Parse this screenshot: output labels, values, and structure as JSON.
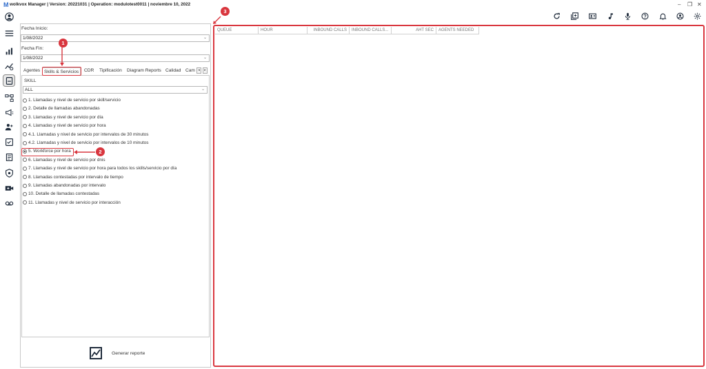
{
  "titlebar": {
    "logo": "M",
    "title": "wolkvox Manager  | Version: 20221031  |  Operation: modulotest0011  |  noviembre 10, 2022",
    "minimize": "–",
    "restore": "❐",
    "close": "✕"
  },
  "form": {
    "fecha_inicio_label": "Fecha Inicio:",
    "fecha_inicio_value": "1/08/2022",
    "fecha_fin_label": "Fecha Fin:",
    "fecha_fin_value": "1/08/2022"
  },
  "tabs": [
    {
      "label": "Agentes"
    },
    {
      "label": "Skills & Servicios"
    },
    {
      "label": "CDR"
    },
    {
      "label": "Tipificación"
    },
    {
      "label": "Diagram Reports"
    },
    {
      "label": "Calidad"
    },
    {
      "label": "Cam"
    }
  ],
  "tabnav": {
    "prev": "◂",
    "next": "▸"
  },
  "skill": {
    "label": "SKILL",
    "value": "ALL"
  },
  "reports": [
    {
      "label": "1. Llamadas y nivel de servicio por skill/servicio",
      "selected": false
    },
    {
      "label": "2. Detalle de llamadas abandonadas",
      "selected": false
    },
    {
      "label": "3. Llamadas y nivel de servicio por día",
      "selected": false
    },
    {
      "label": "4. Llamadas y nivel de servicio por hora",
      "selected": false
    },
    {
      "label": "4.1. Llamadas y nivel de servicio por intervalos de 30 minutos",
      "selected": false
    },
    {
      "label": "4.2. Llamadas y nivel de servicio por intervalos de 10 minutos",
      "selected": false
    },
    {
      "label": "5. Workforce por hora",
      "selected": true
    },
    {
      "label": "6. Llamadas y nivel de servicio por dnis",
      "selected": false
    },
    {
      "label": "7. Llamadas y nivel de servicio por hora para todos los skills/servicio por día",
      "selected": false
    },
    {
      "label": "8. Llamadas contestadas por intervalo de tiempo",
      "selected": false
    },
    {
      "label": "9. Llamadas abandonadas por intervalo",
      "selected": false
    },
    {
      "label": "10. Detalle de llamadas contestadas",
      "selected": false
    },
    {
      "label": "11. Llamadas y nivel de servicio por interacción",
      "selected": false
    }
  ],
  "generate_button": {
    "label": "Generar reporte"
  },
  "grid": {
    "columns": [
      "QUEUE",
      "HOUR",
      "INBOUND CALLS",
      "INBOUND CALLS...",
      "AHT SEC",
      "AGENTS NEEDED"
    ]
  },
  "annotations": {
    "badge1": "1",
    "badge2": "2",
    "badge3": "3"
  },
  "colors": {
    "highlight": "#d9363e",
    "icon": "#1e2a3a"
  }
}
